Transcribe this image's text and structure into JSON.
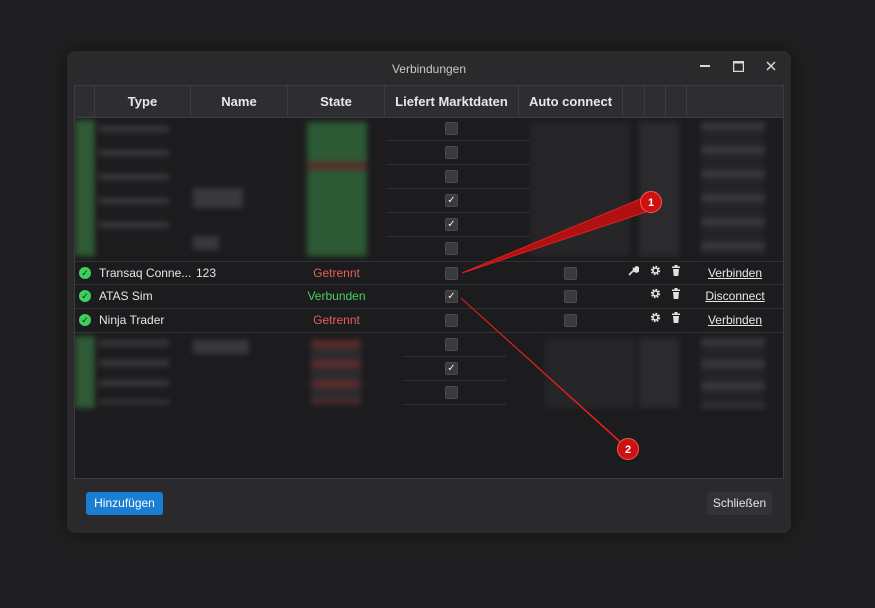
{
  "window": {
    "title": "Verbindungen"
  },
  "columns": [
    "Type",
    "Name",
    "State",
    "Liefert Marktdaten",
    "Auto connect"
  ],
  "rows": [
    {
      "type": "Transaq Conne...",
      "name": "123",
      "state": "Getrennt",
      "state_color": "#e0605a",
      "market_data": false,
      "auto_connect": false,
      "action": "Verbinden"
    },
    {
      "type": "ATAS Sim",
      "name": "",
      "state": "Verbunden",
      "state_color": "#4ccf5f",
      "market_data": true,
      "auto_connect": false,
      "action": "Disconnect"
    },
    {
      "type": "Ninja Trader",
      "name": "",
      "state": "Getrennt",
      "state_color": "#e0605a",
      "market_data": false,
      "auto_connect": false,
      "action": "Verbinden"
    }
  ],
  "blurred_market_data_top": [
    false,
    false,
    false,
    true,
    true,
    false
  ],
  "blurred_market_data_bottom": [
    false,
    true,
    false
  ],
  "buttons": {
    "add": "Hinzufügen",
    "close": "Schließen"
  },
  "annotations": [
    "1",
    "2"
  ],
  "colors": {
    "accent": "#1a7fd4",
    "annotation": "#cc1111",
    "ok": "#3ecf5e"
  }
}
